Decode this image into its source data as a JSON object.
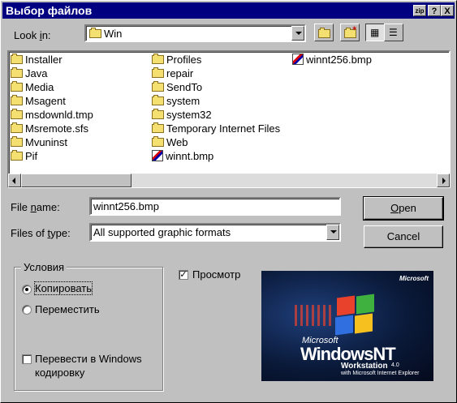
{
  "window": {
    "title": "Выбор файлов",
    "btn_help": "?",
    "btn_close": "X",
    "btn_zip": "zip"
  },
  "look_in": {
    "label_pre": "Look ",
    "label_u": "i",
    "label_post": "n:",
    "value": "Win"
  },
  "files": {
    "col1": [
      "Installer",
      "Java",
      "Media",
      "Msagent",
      "msdownld.tmp",
      "Msremote.sfs",
      "Mvuninst",
      "Pif"
    ],
    "col2": [
      "Profiles",
      "repair",
      "SendTo",
      "system",
      "system32",
      "Temporary Internet Files",
      "Web",
      "winnt.bmp"
    ],
    "col3": [
      "winnt256.bmp"
    ]
  },
  "file_name": {
    "label_pre": "File ",
    "label_u": "n",
    "label_post": "ame:",
    "value": "winnt256.bmp"
  },
  "file_type": {
    "label_pre": "Files of ",
    "label_u": "t",
    "label_post": "ype:",
    "value": "All supported graphic formats"
  },
  "buttons": {
    "open_u": "O",
    "open_rest": "pen",
    "cancel": "Cancel"
  },
  "conditions": {
    "legend": "Условия",
    "copy": "Копировать",
    "move": "Переместить",
    "convert_line1": "Перевести в Windows",
    "convert_line2": "кодировку"
  },
  "preview": {
    "label": "Просмотр",
    "checked": true,
    "ms_small": "Microsoft",
    "brand_small": "Microsoft",
    "product": "WindowsNT",
    "edition": "Workstation",
    "version": "4.0",
    "bundled": "with Microsoft Internet Explorer"
  }
}
